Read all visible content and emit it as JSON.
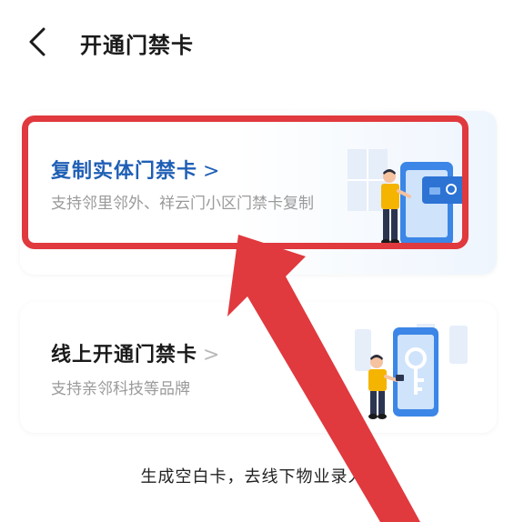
{
  "header": {
    "title": "开通门禁卡",
    "back_icon": "chevron-left-icon"
  },
  "cards": [
    {
      "title": "复制实体门禁卡",
      "chevron": ">",
      "description": "支持邻里邻外、祥云门小区门禁卡复制"
    },
    {
      "title": "线上开通门禁卡",
      "chevron": ">",
      "description": "支持亲邻科技等品牌"
    }
  ],
  "bottom_link": {
    "label": "生成空白卡，去线下物业录入",
    "chevron": ">"
  },
  "colors": {
    "title_blue": "#1f5fb5",
    "annotation_red": "#e0393e",
    "accent_blue": "#3b86e6",
    "figure_yellow": "#f4b400"
  }
}
